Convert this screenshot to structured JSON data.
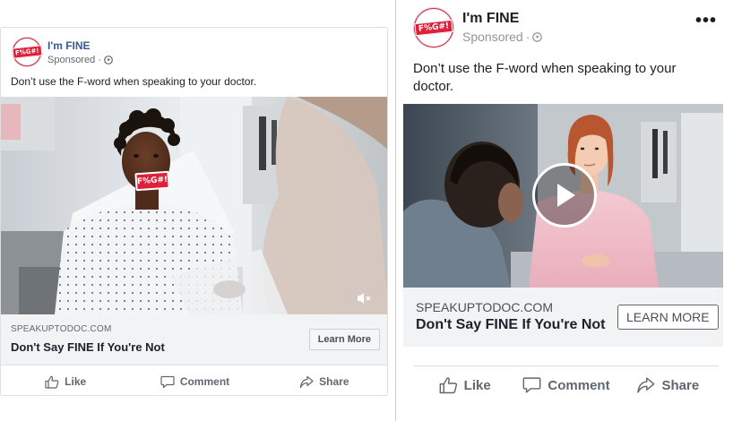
{
  "left_ad": {
    "page_name": "I'm FINE",
    "sponsored": "Sponsored",
    "dot": "·",
    "post_text": "Don’t use the F-word when speaking to your doctor.",
    "logo_text": "F%G#!",
    "mouth_censor_text": "F%G#!",
    "link_domain": "SPEAKUPTODOC.COM",
    "link_headline": "Don't Say FINE If You're Not",
    "cta_label": "Learn More",
    "actions": {
      "like": "Like",
      "comment": "Comment",
      "share": "Share"
    }
  },
  "right_ad": {
    "page_name": "I'm FINE",
    "sponsored": "Sponsored",
    "dot": "·",
    "more": "•••",
    "post_text": "Don’t use the F-word when speaking to your doctor.",
    "logo_text": "F%G#!",
    "link_domain": "SPEAKUPTODOC.COM",
    "link_headline": "Don't Say FINE If You're Not",
    "cta_label": "LEARN MORE",
    "actions": {
      "like": "Like",
      "comment": "Comment",
      "share": "Share"
    }
  },
  "colors": {
    "brand_red": "#e0203a",
    "link_blue": "#385898",
    "link_area_bg": "#f2f3f5",
    "secondary_text": "#606770"
  },
  "icons": [
    "globe-icon",
    "like-icon",
    "comment-icon",
    "share-icon",
    "mute-icon",
    "play-icon",
    "more-options-icon"
  ]
}
